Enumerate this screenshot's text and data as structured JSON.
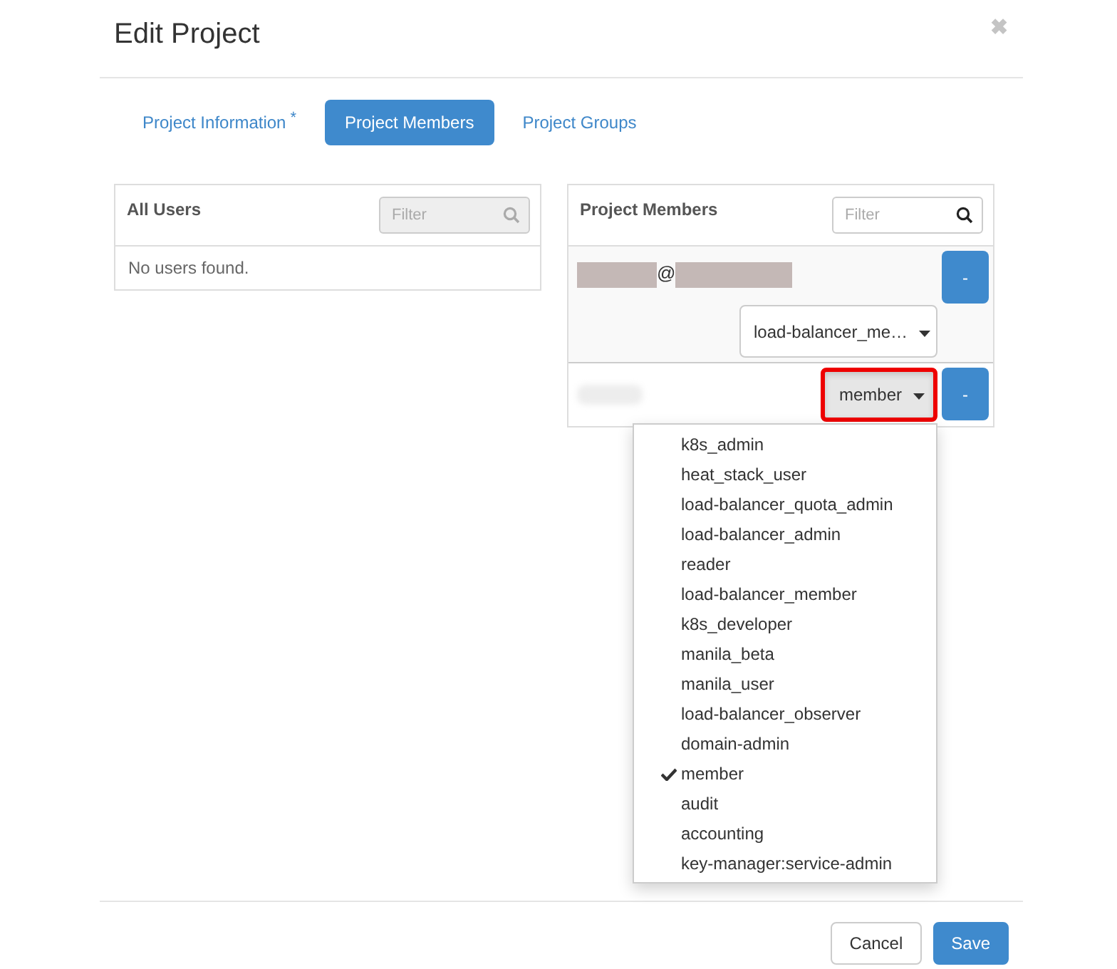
{
  "dialog": {
    "title": "Edit Project",
    "close": "✖"
  },
  "tabs": [
    {
      "label": "Project Information",
      "required": "*",
      "selected": false
    },
    {
      "label": "Project Members",
      "selected": true
    },
    {
      "label": "Project Groups",
      "selected": false
    }
  ],
  "all_users": {
    "title": "All Users",
    "filter": {
      "placeholder": "Filter",
      "disabled": true
    },
    "empty": "No users found."
  },
  "project_members": {
    "title": "Project Members",
    "filter": {
      "placeholder": "Filter",
      "disabled": false
    },
    "members": [
      {
        "name_parts": [
          {
            "kind": "redacted"
          },
          {
            "kind": "text",
            "text": "@"
          },
          {
            "kind": "redacted"
          }
        ],
        "role": "load-balancer_me…",
        "open": false,
        "role_below": true,
        "remove": "-"
      },
      {
        "name_parts": [
          {
            "kind": "blurred"
          }
        ],
        "role": "member",
        "open": true,
        "role_below": false,
        "remove": "-"
      }
    ],
    "role_options": [
      {
        "label": "k8s_admin",
        "selected": false
      },
      {
        "label": "heat_stack_user",
        "selected": false
      },
      {
        "label": "load-balancer_quota_admin",
        "selected": false
      },
      {
        "label": "load-balancer_admin",
        "selected": false
      },
      {
        "label": "reader",
        "selected": false
      },
      {
        "label": "load-balancer_member",
        "selected": false
      },
      {
        "label": "k8s_developer",
        "selected": false
      },
      {
        "label": "manila_beta",
        "selected": false
      },
      {
        "label": "manila_user",
        "selected": false
      },
      {
        "label": "load-balancer_observer",
        "selected": false
      },
      {
        "label": "domain-admin",
        "selected": false
      },
      {
        "label": "member",
        "selected": true
      },
      {
        "label": "audit",
        "selected": false
      },
      {
        "label": "accounting",
        "selected": false
      },
      {
        "label": "key-manager:service-admin",
        "selected": false
      }
    ]
  },
  "buttons": [
    {
      "label": "Cancel",
      "kind": "default"
    },
    {
      "label": "Save",
      "kind": "primary"
    }
  ]
}
